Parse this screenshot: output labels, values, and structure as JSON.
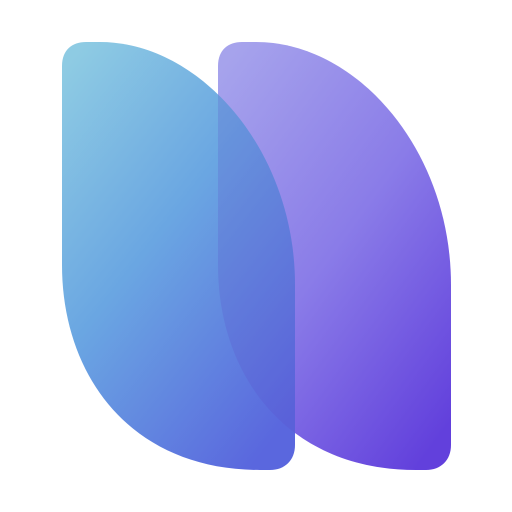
{
  "logo": {
    "icon": "overlapping-leaf-shapes-logo-icon",
    "colors": {
      "left_top": "#8ecbe3",
      "left_mid": "#6aa6e2",
      "left_bottom": "#5a67de",
      "right_top": "#a6a3ec",
      "right_mid": "#8a7ce8",
      "right_bottom": "#6240dc",
      "overlap_shadow": "#5a4fc8"
    }
  }
}
